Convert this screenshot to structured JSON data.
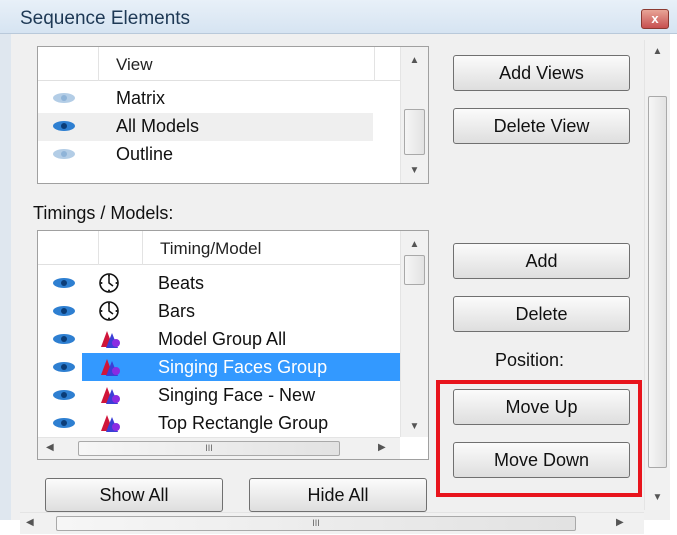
{
  "window": {
    "title": "Sequence Elements",
    "close_glyph": "x"
  },
  "views": {
    "header": "View",
    "items": [
      {
        "label": "Matrix",
        "eye": "dim"
      },
      {
        "label": "All Models",
        "eye": "active"
      },
      {
        "label": "Outline",
        "eye": "dim"
      }
    ],
    "add_button": "Add Views",
    "delete_button": "Delete View"
  },
  "timings": {
    "section_label": "Timings / Models:",
    "header": "Timing/Model",
    "items": [
      {
        "label": "Beats",
        "icon": "clock-icon"
      },
      {
        "label": "Bars",
        "icon": "clock-icon"
      },
      {
        "label": "Model Group All",
        "icon": "model-group-icon"
      },
      {
        "label": "Singing Faces Group",
        "icon": "model-group-icon",
        "selected": true
      },
      {
        "label": "Singing Face - New",
        "icon": "model-group-icon"
      },
      {
        "label": "Top Rectangle Group",
        "icon": "model-group-icon"
      }
    ],
    "hscroll_grip": "III",
    "add_button": "Add",
    "delete_button": "Delete",
    "position_label": "Position:",
    "move_up_button": "Move Up",
    "move_down_button": "Move Down",
    "show_all_button": "Show All",
    "hide_all_button": "Hide All"
  },
  "scrollbars": {
    "up": "▲",
    "down": "▼",
    "left": "◀",
    "right": "▶",
    "grip": "III"
  },
  "colors": {
    "selection": "#3399ff",
    "highlight_box": "#e8141c",
    "eye": "#2e7fd1"
  }
}
